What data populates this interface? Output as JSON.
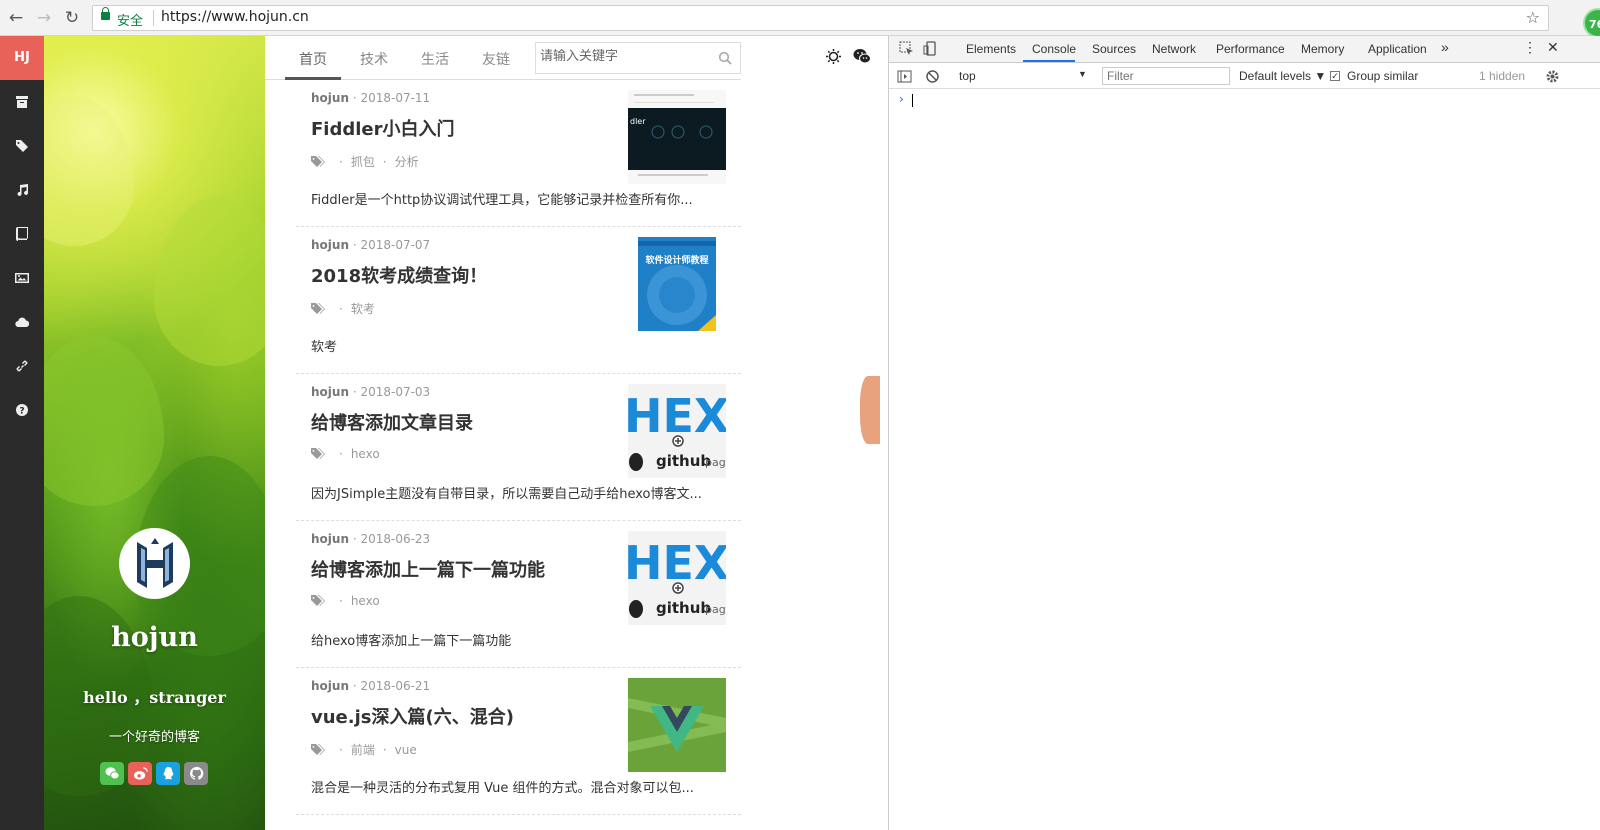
{
  "browser": {
    "secure_label": "安全",
    "url": "https://www.hojun.cn",
    "extension_badge": "76"
  },
  "rail": {
    "logo": "HJ",
    "icons": [
      "archive-icon",
      "tags-icon",
      "music-icon",
      "book-icon",
      "image-icon",
      "cloud-icon",
      "link-icon",
      "help-icon"
    ]
  },
  "profile": {
    "name": "hojun",
    "greeting": "hello ，stranger",
    "motto": "一个好奇的博客",
    "socials": [
      {
        "name": "wechat",
        "color": "#4fc14f"
      },
      {
        "name": "weibo",
        "color": "#e8625a"
      },
      {
        "name": "qq",
        "color": "#1aa1e0"
      },
      {
        "name": "github",
        "color": "#8a8a8a"
      }
    ]
  },
  "nav": {
    "tabs": [
      "首页",
      "技术",
      "生活",
      "友链"
    ],
    "search_placeholder": "请输入关键字"
  },
  "posts": [
    {
      "author": "hojun",
      "date": "· 2018-07-11",
      "title": "Fiddler小白入门",
      "tags": [
        "抓包",
        "分析"
      ],
      "excerpt": "Fiddler是一个http协议调试代理工具，它能够记录并检查所有你..."
    },
    {
      "author": "hojun",
      "date": "· 2018-07-07",
      "title": "2018软考成绩查询！",
      "tags": [
        "软考"
      ],
      "excerpt": "软考"
    },
    {
      "author": "hojun",
      "date": "· 2018-07-03",
      "title": "给博客添加文章目录",
      "tags": [
        "hexo"
      ],
      "excerpt": "因为JSimple主题没有自带目录，所以需要自己动手给hexo博客文..."
    },
    {
      "author": "hojun",
      "date": "· 2018-06-23",
      "title": "给博客添加上一篇下一篇功能",
      "tags": [
        "hexo"
      ],
      "excerpt": "给hexo博客添加上一篇下一篇功能"
    },
    {
      "author": "hojun",
      "date": "· 2018-06-21",
      "title": "vue.js深入篇(六、混合)",
      "tags": [
        "前端",
        "vue"
      ],
      "excerpt": "混合是一种灵活的分布式复用 Vue 组件的方式。混合对象可以包..."
    }
  ],
  "thumbs": {
    "book_title": "软件设计师教程",
    "hexo_text": "HEX",
    "github_text": "github",
    "pages_text": "pag",
    "fiddler_text": "dler"
  },
  "devtools": {
    "tabs": [
      "Elements",
      "Console",
      "Sources",
      "Network",
      "Performance",
      "Memory",
      "Application",
      "»"
    ],
    "active_tab": "Console",
    "context": "top",
    "filter_placeholder": "Filter",
    "levels": "Default levels ▼",
    "group_similar": "Group similar",
    "hidden_count": "1 hidden",
    "prompt": "›",
    "accent": "#1a73e8"
  }
}
